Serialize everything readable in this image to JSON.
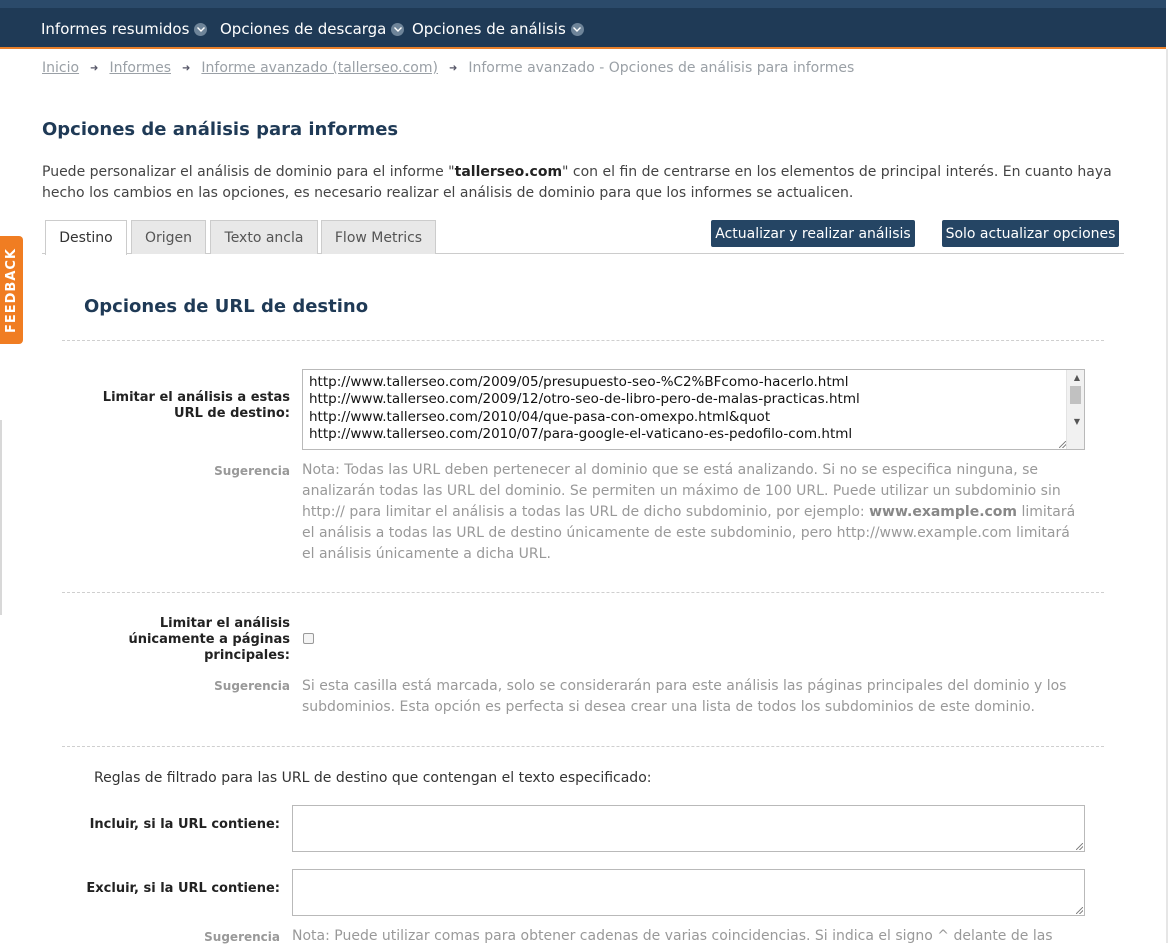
{
  "nav": {
    "items": [
      {
        "label": "Informes resumidos"
      },
      {
        "label": "Opciones de descarga"
      },
      {
        "label": "Opciones de análisis"
      }
    ]
  },
  "breadcrumb": {
    "items": [
      "Inicio",
      "Informes",
      "Informe avanzado (tallerseo.com)"
    ],
    "current": "Informe avanzado - Opciones de análisis para informes"
  },
  "page": {
    "title": "Opciones de análisis para informes",
    "intro_pre": "Puede personalizar el análisis de dominio para el informe \"",
    "intro_domain": "tallerseo.com",
    "intro_post": "\" con el fin de centrarse en los elementos de principal interés. En cuanto haya hecho los cambios en las opciones, es necesario realizar el análisis de dominio para que los informes se actualicen."
  },
  "tabs": [
    {
      "label": "Destino",
      "active": true
    },
    {
      "label": "Origen",
      "active": false
    },
    {
      "label": "Texto ancla",
      "active": false
    },
    {
      "label": "Flow Metrics",
      "active": false
    }
  ],
  "buttons": {
    "update_analyze": "Actualizar y realizar análisis",
    "update_only": "Solo actualizar opciones"
  },
  "section": {
    "title": "Opciones de URL de destino",
    "limit_urls_label_1": "Limitar el análisis a estas",
    "limit_urls_label_2": "URL de destino:",
    "urls": [
      "http://www.tallerseo.com/2009/05/presupuesto-seo-%C2%BFcomo-hacerlo.html",
      "http://www.tallerseo.com/2009/12/otro-seo-de-libro-pero-de-malas-practicas.html",
      "http://www.tallerseo.com/2010/04/que-pasa-con-omexpo.html&quot",
      "http://www.tallerseo.com/2010/07/para-google-el-vaticano-es-pedofilo-com.html"
    ],
    "hint_label": "Sugerencia",
    "hint1_a": "Nota: Todas las URL deben pertenecer al dominio que se está analizando. Si no se especifica ninguna, se analizarán todas las URL del dominio. Se permiten un máximo de 100 URL. Puede utilizar un subdominio sin http:// para limitar el análisis a todas las URL de dicho subdominio, por ejemplo: ",
    "hint1_b": "www.example.com",
    "hint1_c": " limitará el análisis a todas las URL de destino únicamente de este subdominio, pero http://www.example.com limitará el análisis únicamente a dicha URL.",
    "main_pages_label_1": "Limitar el análisis",
    "main_pages_label_2": "únicamente a páginas",
    "main_pages_label_3": "principales:",
    "hint2": "Si esta casilla está marcada, solo se considerarán para este análisis las páginas principales del dominio y los subdominios. Esta opción es perfecta si desea crear una lista de todos los subdominios de este dominio.",
    "filter_intro": "Reglas de filtrado para las URL de destino que contengan el texto especificado:",
    "include_label": "Incluir, si la URL contiene:",
    "exclude_label": "Excluir, si la URL contiene:",
    "hint3": "Nota: Puede utilizar comas para obtener cadenas de varias coincidencias. Si indica el signo ^ delante de las"
  },
  "feedback": {
    "label": "FEEDBACK"
  },
  "colors": {
    "navbar": "#1f3a56",
    "accent": "#e9802b",
    "button": "#254564",
    "feedback": "#f07d22"
  }
}
